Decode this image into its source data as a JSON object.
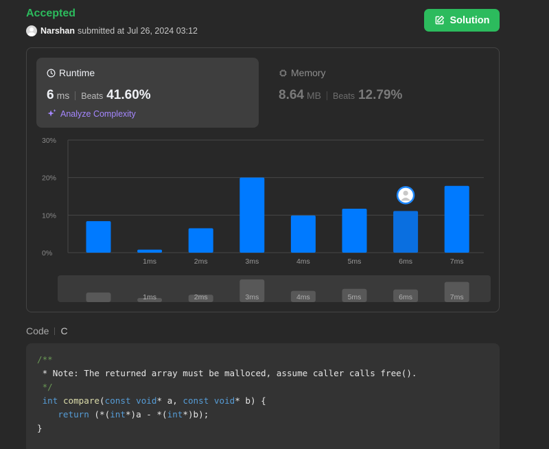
{
  "header": {
    "status": "Accepted",
    "username": "Narshan",
    "submitted_text": "submitted at",
    "datetime": "Jul 26, 2024 03:12",
    "solution_label": "Solution"
  },
  "runtime": {
    "title": "Runtime",
    "value": "6",
    "unit": "ms",
    "beats_label": "Beats",
    "beats": "41.60%",
    "analyze_label": "Analyze Complexity"
  },
  "memory": {
    "title": "Memory",
    "value": "8.64",
    "unit": "MB",
    "beats_label": "Beats",
    "beats": "12.79%"
  },
  "colors": {
    "accepted": "#2cbb5d",
    "bar": "#007aff",
    "bar_active": "#0a6fe0",
    "analyze": "#a587ff"
  },
  "chart_data": {
    "type": "bar",
    "ylim": [
      0,
      30
    ],
    "yticks": [
      "0%",
      "10%",
      "20%",
      "30%"
    ],
    "categories": [
      "",
      "1ms",
      "2ms",
      "3ms",
      "4ms",
      "5ms",
      "6ms",
      "7ms"
    ],
    "values": [
      8.4,
      0.8,
      6.5,
      20.0,
      9.9,
      11.7,
      11.1,
      17.8
    ],
    "highlight_index": 6,
    "grid": true,
    "minimap": {
      "labels": [
        "",
        "1ms",
        "2ms",
        "3ms",
        "4ms",
        "5ms",
        "6ms",
        "7ms"
      ],
      "values": [
        8.4,
        0.8,
        6.5,
        20.0,
        9.9,
        11.7,
        11.1,
        17.8
      ]
    }
  },
  "code": {
    "header_label": "Code",
    "language": "C",
    "lines": [
      [
        {
          "t": "/**",
          "c": "comment"
        }
      ],
      [
        {
          "t": " * Note: The returned array must be malloced, assume caller calls free().",
          "c": "plain"
        }
      ],
      [
        {
          "t": " */",
          "c": "comment"
        }
      ],
      [
        {
          "t": " ",
          "c": "plain"
        },
        {
          "t": "int",
          "c": "kw"
        },
        {
          "t": " ",
          "c": "plain"
        },
        {
          "t": "compare",
          "c": "fn"
        },
        {
          "t": "(",
          "c": "plain"
        },
        {
          "t": "const",
          "c": "kw"
        },
        {
          "t": " ",
          "c": "plain"
        },
        {
          "t": "void",
          "c": "kw"
        },
        {
          "t": "* a, ",
          "c": "plain"
        },
        {
          "t": "const",
          "c": "kw"
        },
        {
          "t": " ",
          "c": "plain"
        },
        {
          "t": "void",
          "c": "kw"
        },
        {
          "t": "* b) {",
          "c": "plain"
        }
      ],
      [
        {
          "t": "    ",
          "c": "plain"
        },
        {
          "t": "return",
          "c": "kw"
        },
        {
          "t": " (*(",
          "c": "plain"
        },
        {
          "t": "int",
          "c": "kw"
        },
        {
          "t": "*)a - *(",
          "c": "plain"
        },
        {
          "t": "int",
          "c": "kw"
        },
        {
          "t": "*)b);",
          "c": "plain"
        }
      ],
      [
        {
          "t": "}",
          "c": "plain"
        }
      ]
    ]
  }
}
